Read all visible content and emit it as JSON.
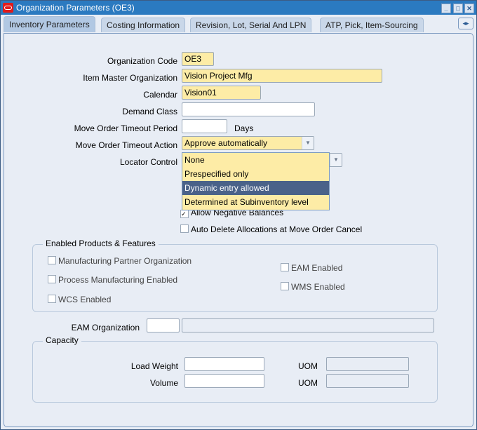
{
  "window": {
    "title": "Organization Parameters (OE3)",
    "controls": [
      "minimize",
      "maximize",
      "close"
    ]
  },
  "tabs": [
    {
      "label": "Inventory Parameters",
      "active": true
    },
    {
      "label": "Costing Information",
      "active": false
    },
    {
      "label": "Revision, Lot, Serial And LPN",
      "active": false
    },
    {
      "label": "ATP, Pick, Item-Sourcing",
      "active": false
    }
  ],
  "form": {
    "org_code": {
      "label": "Organization Code",
      "value": "OE3"
    },
    "item_master_org": {
      "label": "Item Master Organization",
      "value": "Vision Project Mfg"
    },
    "calendar": {
      "label": "Calendar",
      "value": "Vision01"
    },
    "demand_class": {
      "label": "Demand Class",
      "value": ""
    },
    "timeout_period": {
      "label": "Move Order Timeout Period",
      "value": "",
      "unit": "Days"
    },
    "timeout_action": {
      "label": "Move Order Timeout Action",
      "value": "Approve automatically"
    },
    "locator_control": {
      "label": "Locator Control",
      "options": [
        "None",
        "Prespecified only",
        "Dynamic entry allowed",
        "Determined at Subinventory level"
      ],
      "highlighted": "Dynamic entry allowed"
    },
    "allow_negative": {
      "label": "Allow Negative Balances",
      "checked": true
    },
    "auto_delete": {
      "label": "Auto Delete Allocations at Move Order Cancel",
      "checked": false
    }
  },
  "enabled_products": {
    "title": "Enabled Products & Features",
    "items": [
      {
        "label": "Manufacturing Partner Organization",
        "checked": false
      },
      {
        "label": "Process Manufacturing Enabled",
        "checked": false
      },
      {
        "label": "WCS Enabled",
        "checked": false
      },
      {
        "label": "EAM Enabled",
        "checked": false
      },
      {
        "label": "WMS Enabled",
        "checked": false
      }
    ]
  },
  "eam_org": {
    "label": "EAM Organization",
    "code": "",
    "name": ""
  },
  "capacity": {
    "title": "Capacity",
    "load_weight": {
      "label": "Load Weight",
      "value": "",
      "uom_label": "UOM",
      "uom": ""
    },
    "volume": {
      "label": "Volume",
      "value": "",
      "uom_label": "UOM",
      "uom": ""
    }
  }
}
